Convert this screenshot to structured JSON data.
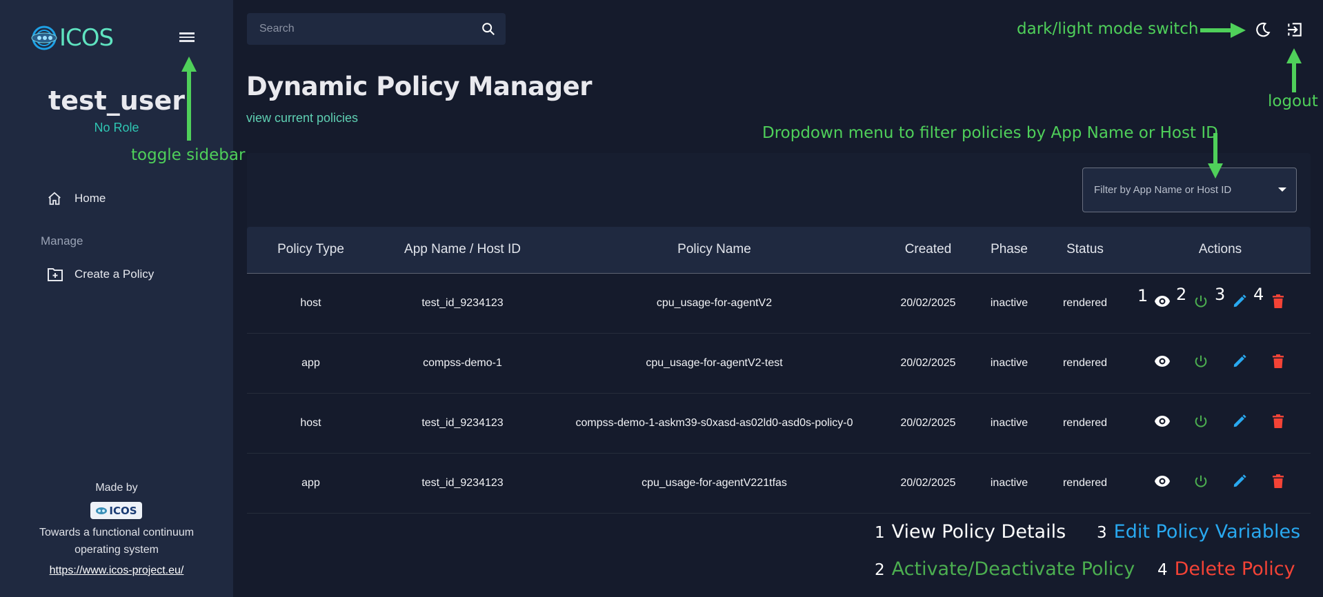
{
  "sidebar": {
    "logo_text": "ICOS",
    "user": {
      "name": "test_user",
      "role": "No Role"
    },
    "nav": [
      {
        "label": "Home",
        "icon": "home-icon"
      }
    ],
    "section_label": "Manage",
    "manage_items": [
      {
        "label": "Create a Policy",
        "icon": "folder-plus-icon"
      }
    ],
    "footer": {
      "made_by": "Made by",
      "logo_text": "ICOS",
      "tagline": "Towards a functional continuum operating system",
      "link": "https://www.icos-project.eu/"
    }
  },
  "topbar": {
    "search_placeholder": "Search",
    "icons": [
      "search-icon",
      "moon-icon",
      "logout-icon"
    ]
  },
  "page": {
    "title": "Dynamic Policy Manager",
    "subtitle": "view current policies",
    "filter_placeholder": "Filter by App Name or Host ID"
  },
  "table": {
    "columns": [
      "Policy Type",
      "App Name / Host ID",
      "Policy Name",
      "Created",
      "Phase",
      "Status",
      "Actions"
    ],
    "rows": [
      {
        "type": "host",
        "target": "test_id_9234123",
        "name": "cpu_usage-for-agentV2",
        "created": "20/02/2025",
        "phase": "inactive",
        "status": "rendered"
      },
      {
        "type": "app",
        "target": "compss-demo-1",
        "name": "cpu_usage-for-agentV2-test",
        "created": "20/02/2025",
        "phase": "inactive",
        "status": "rendered"
      },
      {
        "type": "host",
        "target": "test_id_9234123",
        "name": "compss-demo-1-askm39-s0xasd-as02ld0-asd0s-policy-0",
        "created": "20/02/2025",
        "phase": "inactive",
        "status": "rendered"
      },
      {
        "type": "app",
        "target": "test_id_9234123",
        "name": "cpu_usage-for-agentV221tfas",
        "created": "20/02/2025",
        "phase": "inactive",
        "status": "rendered"
      }
    ],
    "action_numbers": [
      "1",
      "2",
      "3",
      "4"
    ]
  },
  "annotations": {
    "toggle_sidebar": "toggle sidebar",
    "mode_switch": "dark/light mode switch",
    "logout": "logout",
    "dropdown": "Dropdown menu to filter policies by App Name or Host ID"
  },
  "legend": [
    {
      "num": "1",
      "label": "View Policy Details",
      "color": "#ffffff"
    },
    {
      "num": "2",
      "label": "Activate/Deactivate Policy",
      "color": "#4caf50"
    },
    {
      "num": "3",
      "label": "Edit Policy Variables",
      "color": "#29a9f0"
    },
    {
      "num": "4",
      "label": "Delete Policy",
      "color": "#f44336"
    }
  ],
  "colors": {
    "accent": "#5fe3c0",
    "annotation": "#4fd05a",
    "view": "#ffffff",
    "activate": "#4caf50",
    "edit": "#29a9f0",
    "delete": "#f44336"
  }
}
